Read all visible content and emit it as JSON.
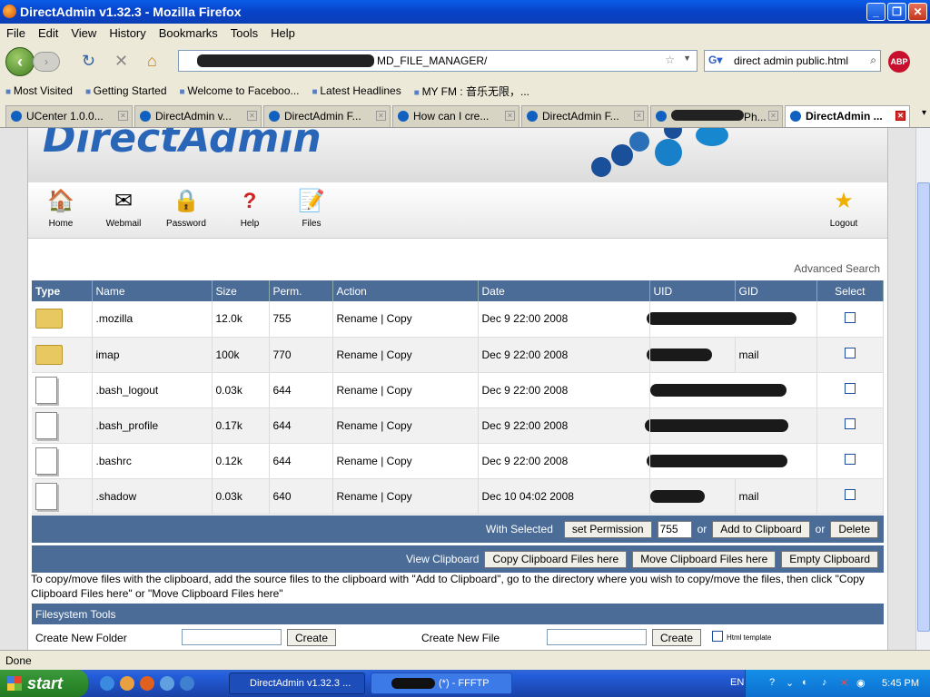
{
  "window": {
    "title": "DirectAdmin v1.32.3 - Mozilla Firefox"
  },
  "menu": [
    "File",
    "Edit",
    "View",
    "History",
    "Bookmarks",
    "Tools",
    "Help"
  ],
  "url": {
    "visible_text": "MD_FILE_MANAGER/"
  },
  "search": {
    "value": "direct admin public.html"
  },
  "abp_label": "ABP",
  "bookmarks": [
    "Most Visited",
    "Getting Started",
    "Welcome to Faceboo...",
    "Latest Headlines",
    "MY FM : 音乐无限，..."
  ],
  "tabs": [
    "UCenter 1.0.0...",
    "DirectAdmin v...",
    "DirectAdmin F...",
    "How can I cre...",
    "DirectAdmin F...",
    "Ph...",
    "DirectAdmin ..."
  ],
  "logo": "DirectAdmin",
  "toolbar": [
    "Home",
    "Webmail",
    "Password",
    "Help",
    "Files",
    "Logout"
  ],
  "advanced_search": "Advanced Search",
  "table": {
    "headers": [
      "Type",
      "Name",
      "Size",
      "Perm.",
      "Action",
      "Date",
      "UID",
      "GID",
      "Select"
    ],
    "rows": [
      {
        "type": "folder",
        "name": ".mozilla",
        "size": "12.0k",
        "perm": "755",
        "rename": "Rename",
        "sep": "|",
        "copy": "Copy",
        "date": "Dec 9 22:00 2008",
        "gid": ""
      },
      {
        "type": "folder",
        "name": "imap",
        "size": "100k",
        "perm": "770",
        "rename": "Rename",
        "sep": "|",
        "copy": "Copy",
        "date": "Dec 9 22:00 2008",
        "gid": "mail"
      },
      {
        "type": "file",
        "name": ".bash_logout",
        "size": "0.03k",
        "perm": "644",
        "rename": "Rename",
        "sep": "|",
        "copy": "Copy",
        "date": "Dec 9 22:00 2008",
        "gid": ""
      },
      {
        "type": "file",
        "name": ".bash_profile",
        "size": "0.17k",
        "perm": "644",
        "rename": "Rename",
        "sep": "|",
        "copy": "Copy",
        "date": "Dec 9 22:00 2008",
        "gid": ""
      },
      {
        "type": "file",
        "name": ".bashrc",
        "size": "0.12k",
        "perm": "644",
        "rename": "Rename",
        "sep": "|",
        "copy": "Copy",
        "date": "Dec 9 22:00 2008",
        "gid": ""
      },
      {
        "type": "file",
        "name": ".shadow",
        "size": "0.03k",
        "perm": "640",
        "rename": "Rename",
        "sep": "|",
        "copy": "Copy",
        "date": "Dec 10 04:02 2008",
        "gid": "mail"
      }
    ]
  },
  "with_selected": {
    "label": "With Selected",
    "set_permission": "set Permission",
    "perm_value": "755",
    "or": "or",
    "add_clipboard": "Add to Clipboard",
    "delete": "Delete"
  },
  "clipboard": {
    "label": "View Clipboard",
    "copy": "Copy Clipboard Files here",
    "move": "Move Clipboard Files here",
    "empty": "Empty Clipboard"
  },
  "note": "To copy/move files with the clipboard, add the source files to the clipboard with \"Add to Clipboard\", go to the directory where you wish to copy/move the files, then click \"Copy Clipboard Files here\" or \"Move Clipboard Files here\"",
  "fs_tools": {
    "title": "Filesystem Tools",
    "new_folder": "Create New Folder",
    "create": "Create",
    "new_file": "Create New File",
    "html_template": "Html template"
  },
  "status": "Done",
  "taskbar": {
    "start": "start",
    "tasks": [
      "DirectAdmin v1.32.3 ...",
      "(*) - FFFTP"
    ],
    "lang": "EN",
    "clock": "5:45 PM"
  }
}
